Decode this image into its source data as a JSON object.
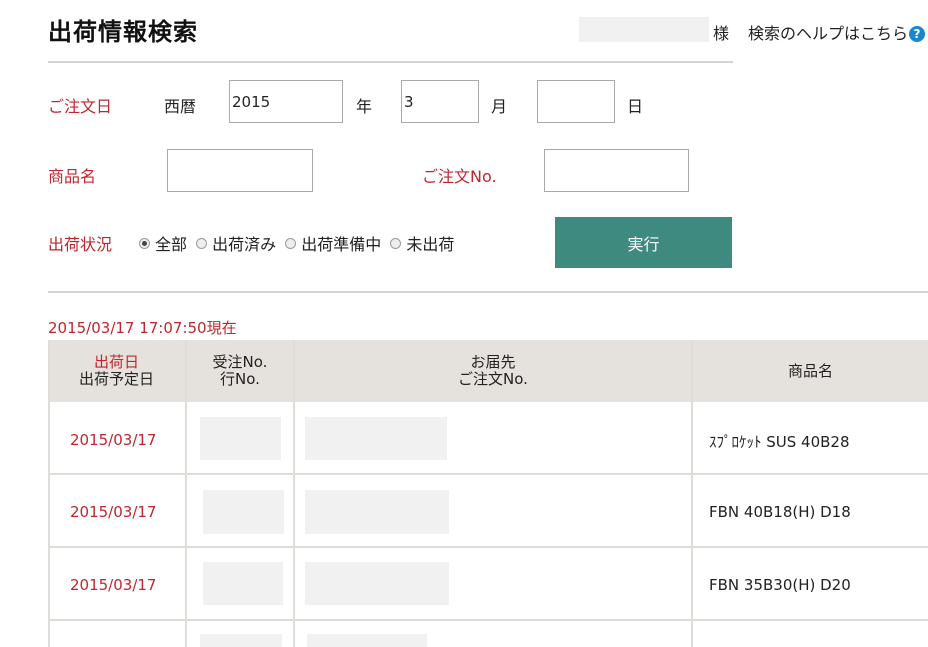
{
  "header": {
    "title": "出荷情報検索",
    "honorific": "様",
    "help_link": "検索のヘルプはこちら",
    "help_icon_glyph": "?"
  },
  "form": {
    "order_date_label": "ご注文日",
    "era_label": "西暦",
    "year_value": "2015",
    "year_suffix": "年",
    "month_value": "3",
    "month_suffix": "月",
    "day_value": "",
    "day_suffix": "日",
    "product_label": "商品名",
    "product_value": "",
    "order_no_label": "ご注文No.",
    "order_no_value": "",
    "status_label": "出荷状況",
    "status_options": [
      "全部",
      "出荷済み",
      "出荷準備中",
      "未出荷"
    ],
    "status_selected": "全部",
    "run_button": "実行"
  },
  "results": {
    "timestamp": "2015/03/17 17:07:50現在",
    "headers": {
      "col1_line1": "出荷日",
      "col1_line2": "出荷予定日",
      "col2_line1": "受注No.",
      "col2_line2": "行No.",
      "col3_line1": "お届先",
      "col3_line2": "ご注文No.",
      "col4": "商品名"
    },
    "rows": [
      {
        "ship_date": "2015/03/17",
        "product": "ｽﾌﾟﾛｹｯﾄ SUS 40B28"
      },
      {
        "ship_date": "2015/03/17",
        "product": "FBN 40B18(H) D18"
      },
      {
        "ship_date": "2015/03/17",
        "product": "FBN 35B30(H) D20"
      },
      {
        "ship_date": "",
        "product": ""
      }
    ]
  },
  "colors": {
    "accent_red": "#c0262b",
    "button_teal": "#3f8a7f",
    "header_bg": "#e5e2dd"
  }
}
